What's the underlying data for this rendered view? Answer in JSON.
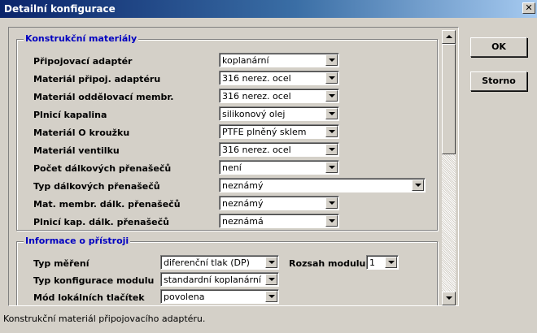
{
  "window": {
    "title": "Detailní konfigurace"
  },
  "buttons": {
    "ok": "OK",
    "cancel": "Storno"
  },
  "status": "Konstrukční materiál připojovacího adaptéru.",
  "materials": {
    "title": "Konstrukční materiály",
    "rows": [
      {
        "label": "Připojovací adaptér",
        "value": "koplanární"
      },
      {
        "label": "Materiál připoj. adaptéru",
        "value": "316 nerez. ocel"
      },
      {
        "label": "Materiál oddělovací membr.",
        "value": "316 nerez. ocel"
      },
      {
        "label": "Plnicí kapalina",
        "value": "silikonový olej"
      },
      {
        "label": "Materiál O kroužku",
        "value": "PTFE plněný sklem"
      },
      {
        "label": "Materiál ventilku",
        "value": "316 nerez. ocel"
      },
      {
        "label": "Počet dálkových přenašečů",
        "value": "není"
      },
      {
        "label": "Typ dálkových přenašečů",
        "value": "neznámý"
      },
      {
        "label": "Mat. membr. dálk. přenašečů",
        "value": "neznámý"
      },
      {
        "label": "Plnicí kap. dálk. přenašečů",
        "value": "neznámá"
      }
    ]
  },
  "device": {
    "title": "Informace o přístroji",
    "measurement_type": {
      "label": "Typ měření",
      "value": "diferenční tlak (DP)"
    },
    "module_range": {
      "label": "Rozsah modulu",
      "value": "1"
    },
    "module_config": {
      "label": "Typ konfigurace modulu",
      "value": "standardní koplanární (C"
    },
    "local_buttons": {
      "label": "Mód lokálních tlačítek",
      "value": "povolena"
    }
  }
}
